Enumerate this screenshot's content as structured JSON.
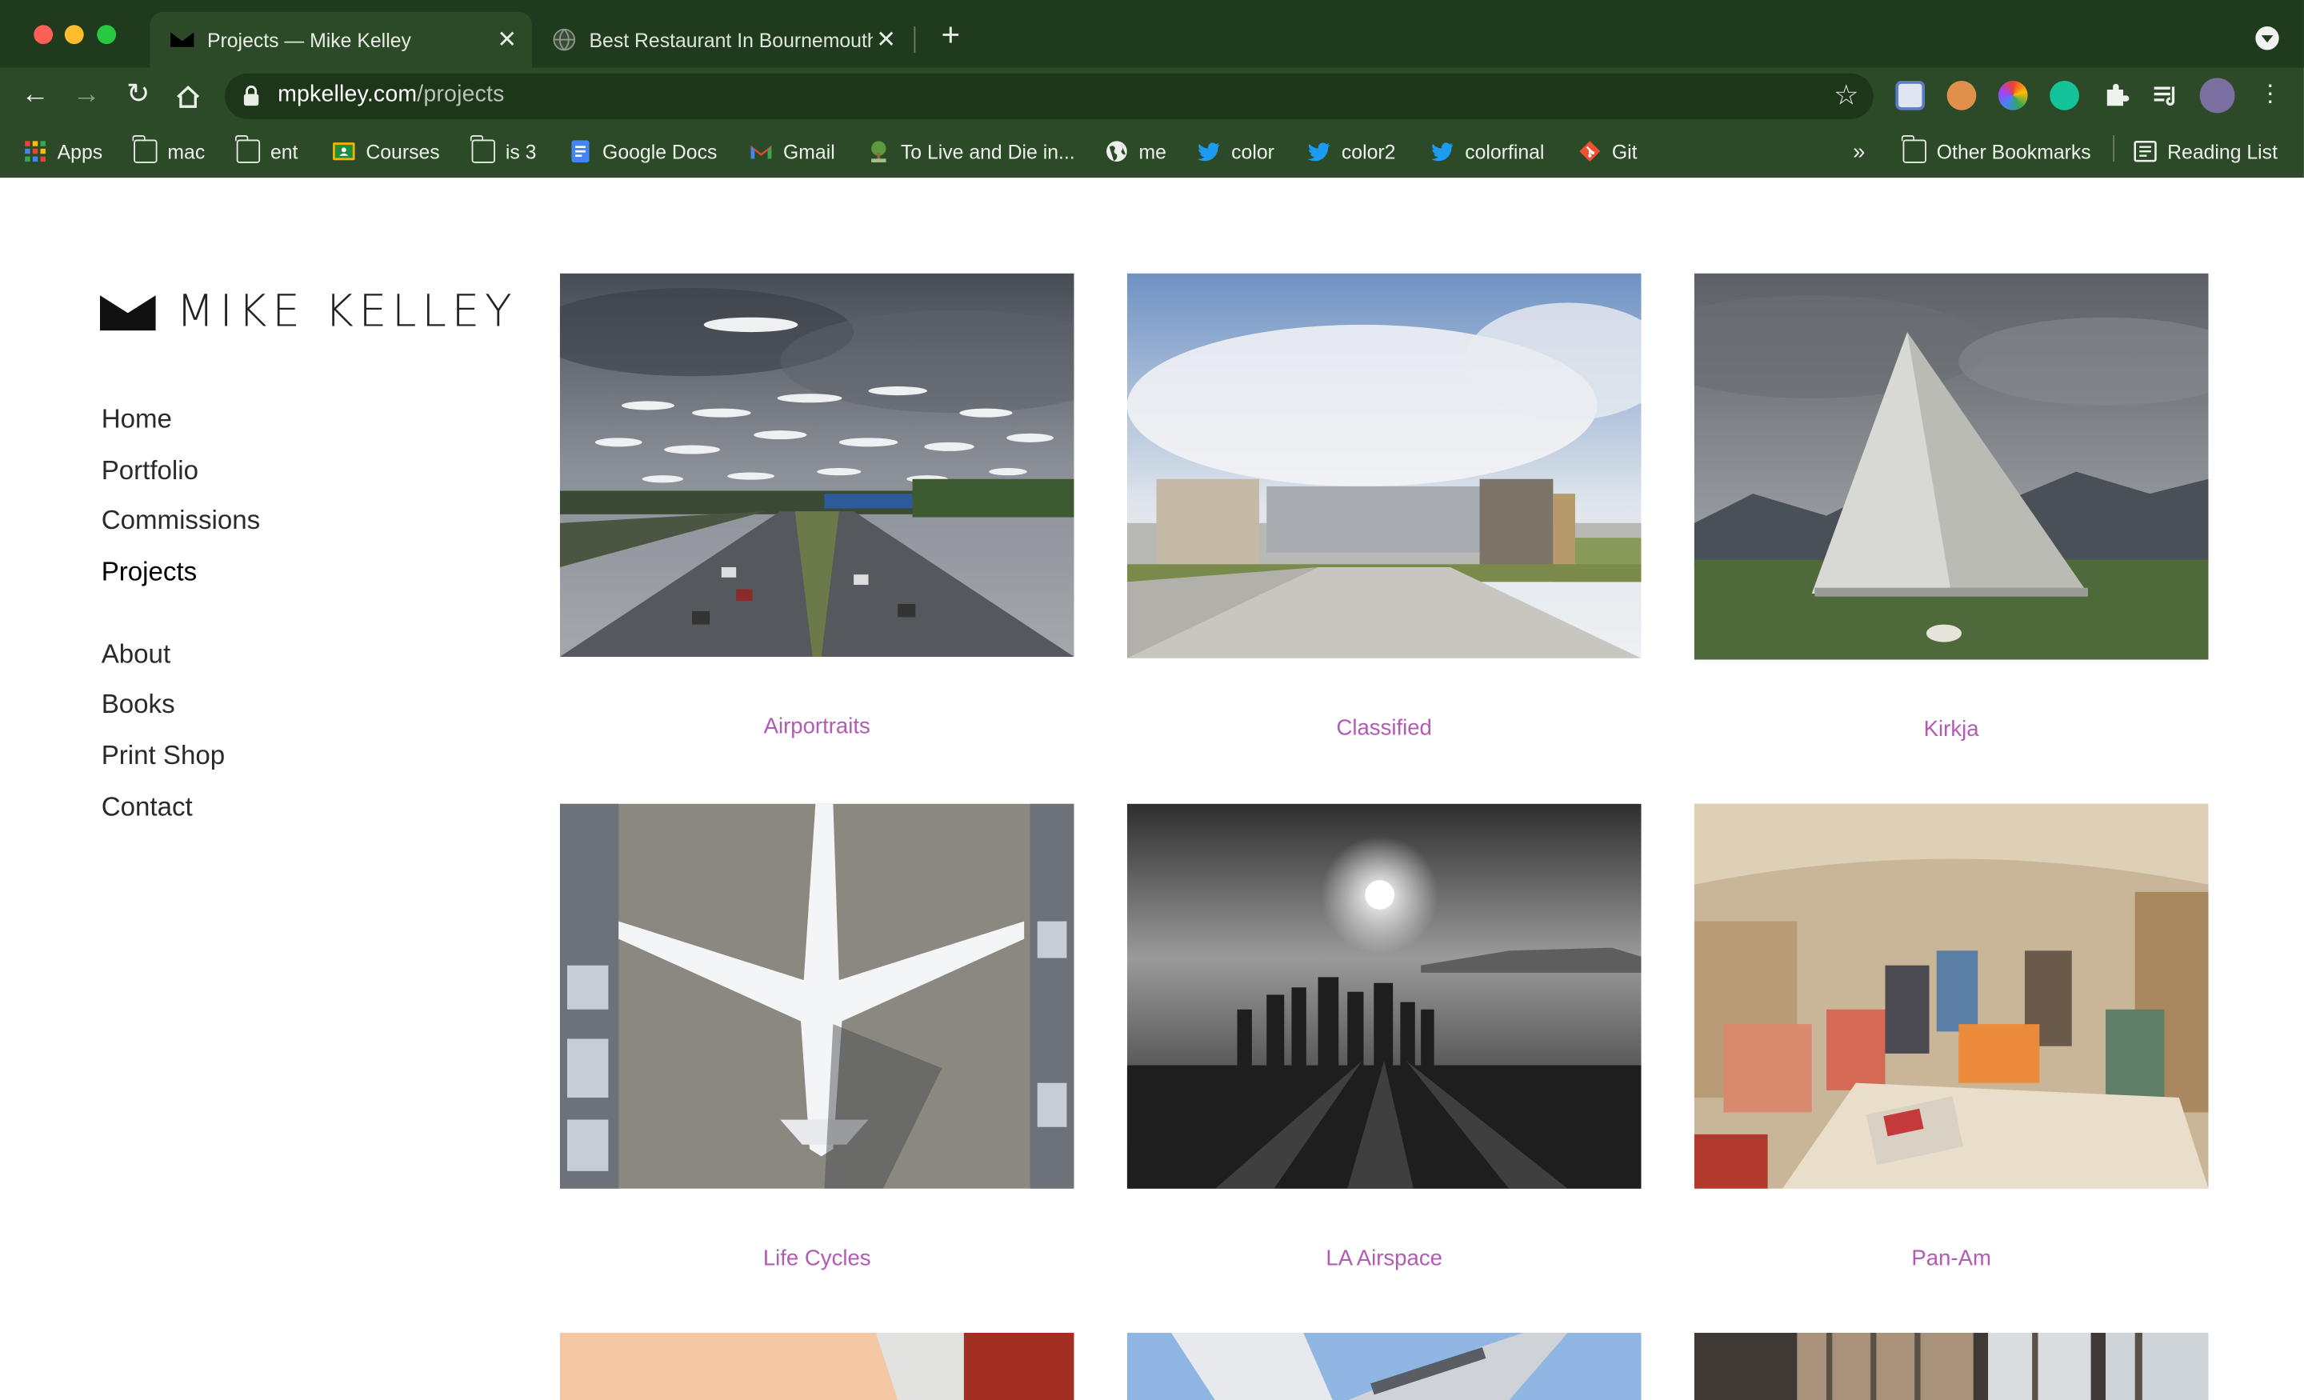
{
  "browser": {
    "tabs": [
      {
        "title": "Projects — Mike Kelley",
        "active": true
      },
      {
        "title": "Best Restaurant In Bournemouth",
        "active": false
      }
    ],
    "url": {
      "host": "mpkelley.com",
      "path": "/projects"
    },
    "bookmarks": [
      {
        "label": "Apps",
        "icon": "apps-grid-icon"
      },
      {
        "label": "mac",
        "icon": "folder-icon"
      },
      {
        "label": "ent",
        "icon": "folder-icon"
      },
      {
        "label": "Courses",
        "icon": "classroom-icon"
      },
      {
        "label": "is 3",
        "icon": "folder-icon"
      },
      {
        "label": "Google Docs",
        "icon": "google-docs-icon"
      },
      {
        "label": "Gmail",
        "icon": "gmail-icon"
      },
      {
        "label": "To Live and Die in...",
        "icon": "tree-icon"
      },
      {
        "label": "me",
        "icon": "globe-icon"
      },
      {
        "label": "color",
        "icon": "twitter-icon"
      },
      {
        "label": "color2",
        "icon": "twitter-icon"
      },
      {
        "label": "colorfinal",
        "icon": "twitter-icon"
      },
      {
        "label": "Git",
        "icon": "git-icon"
      }
    ],
    "overflow_label": "»",
    "other_bookmarks": "Other Bookmarks",
    "reading_list": "Reading List"
  },
  "site": {
    "logo_text": "MIKE KELLEY",
    "nav": [
      {
        "label": "Home"
      },
      {
        "label": "Portfolio"
      },
      {
        "label": "Commissions"
      },
      {
        "label": "Projects",
        "current": true
      }
    ],
    "nav_secondary": [
      {
        "label": "About"
      },
      {
        "label": "Books"
      },
      {
        "label": "Print Shop"
      },
      {
        "label": "Contact"
      }
    ],
    "accent_color": "#b25ab4",
    "projects": [
      {
        "title": "Airportraits"
      },
      {
        "title": "Classified"
      },
      {
        "title": "Kirkja"
      },
      {
        "title": "Life Cycles"
      },
      {
        "title": "LA Airspace"
      },
      {
        "title": "Pan-Am"
      }
    ]
  }
}
